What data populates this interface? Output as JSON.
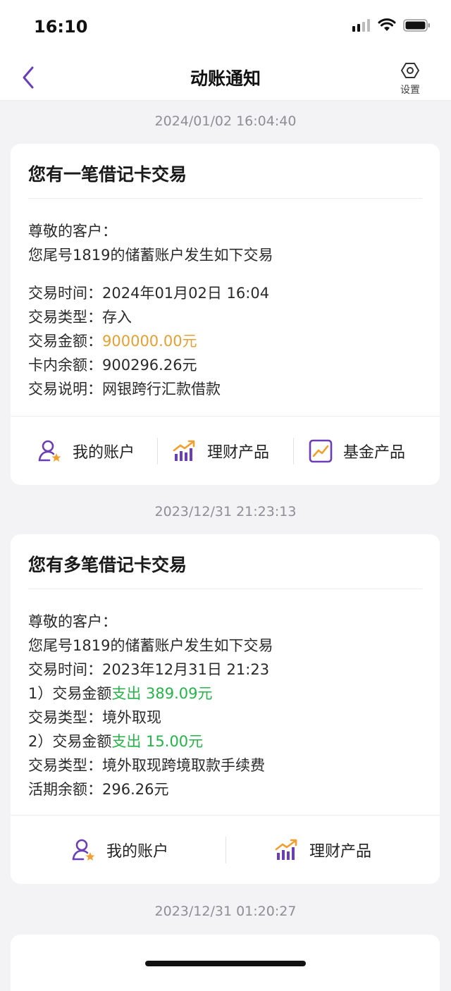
{
  "status_bar": {
    "time": "16:10"
  },
  "nav": {
    "title": "动账通知",
    "settings_label": "设置"
  },
  "notifications": [
    {
      "timestamp": "2024/01/02 16:04:40",
      "title": "您有一笔借记卡交易",
      "greeting": "尊敬的客户：",
      "intro": "您尾号1819的储蓄账户发生如下交易",
      "time_label": "交易时间：",
      "time_value": "2024年01月02日  16:04",
      "type_label": "交易类型：",
      "type_value": "存入",
      "amount_label": "交易金额：",
      "amount_value": "900000.00元",
      "balance_label": "卡内余额：",
      "balance_value": "900296.26元",
      "desc_label": "交易说明：",
      "desc_value": "网银跨行汇款借款",
      "actions": [
        "我的账户",
        "理财产品",
        "基金产品"
      ]
    },
    {
      "timestamp": "2023/12/31 21:23:13",
      "title": "您有多笔借记卡交易",
      "greeting": "尊敬的客户：",
      "intro": "您尾号1819的储蓄账户发生如下交易",
      "time_label": "交易时间：",
      "time_value": "2023年12月31日  21:23",
      "item1_label": "1）交易金额",
      "item1_amount": "支出 389.09元",
      "item1_type_label": "交易类型：",
      "item1_type_value": "境外取现",
      "item2_label": "2）交易金额",
      "item2_amount": "支出 15.00元",
      "item2_type_label": "交易类型：",
      "item2_type_value": "境外取现跨境取款手续费",
      "balance_label": "活期余额：",
      "balance_value": "296.26元",
      "actions": [
        "我的账户",
        "理财产品"
      ]
    },
    {
      "timestamp": "2023/12/31 01:20:27"
    }
  ],
  "colors": {
    "accent_purple": "#6a3fb5",
    "amount_orange": "#e3a034",
    "amount_green": "#27b34a",
    "icon_orange": "#f0a030"
  }
}
